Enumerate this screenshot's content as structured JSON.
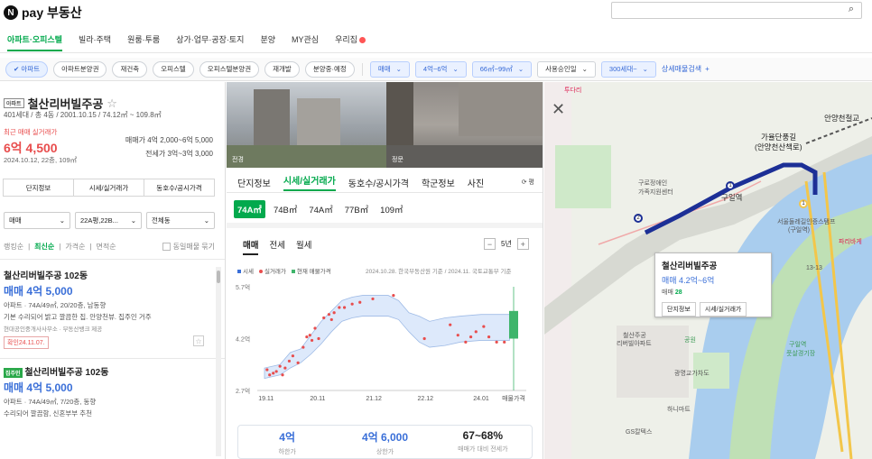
{
  "header": {
    "logo_text": "pay 부동산",
    "logo_mark": "N",
    "search_icon": "⌕"
  },
  "nav": {
    "items": [
      "아파트·오피스텔",
      "빌라·주택",
      "원룸·투룸",
      "상가·업무·공장·토지",
      "분양",
      "MY관심",
      "우리집"
    ]
  },
  "filters": {
    "chips": [
      "✔ 아파트",
      "아파트분양권",
      "재건축",
      "오피스텔",
      "오피스텔분양권",
      "재개발",
      "분양중·예정"
    ],
    "selects": [
      "매매",
      "4억~6억",
      "66㎡~99㎡",
      "사용승인일",
      "300세대~"
    ],
    "detail_label": "상세매물검색",
    "detail_plus": "+"
  },
  "listing": {
    "type_tag": "아파트",
    "title": "철산리버빌주공",
    "star": "☆",
    "subtitle": "401세대 / 총 4동 / 2001.10.15 / 74.12㎡ ~ 109.8㎡",
    "recent_label": "최근 매매 실거래가",
    "recent_price": "6억 4,500",
    "recent_date": "2024.10.12, 22층, 109㎡",
    "sale_range": "매매가 4억 2,000~6억 5,000",
    "jeonse_range": "전세가 3억~3억 3,000",
    "buttons": [
      "단지정보",
      "시세/실거래가",
      "동호수/공시가격"
    ],
    "dropdowns": [
      "매매",
      "22A평,22B...",
      "전체동"
    ],
    "sort": [
      "랭킹순",
      "최신순",
      "가격순",
      "면적순"
    ],
    "same_listing": "동일매물 묶기",
    "items": [
      {
        "title": "철산리버빌주공 102동",
        "price": "매매 4억 5,000",
        "desc1": "아파트 · 74A/49㎡, 20/20층, 남동향",
        "desc2": "기본 수리되어 밝고 깔끔한 집. 안양천뷰. 집주인 거주",
        "source": "현대공인중개사사무소 · 부동산뱅크 제공",
        "badge": "확인24.11.07."
      },
      {
        "tag": "집주인",
        "title": "철산리버빌주공 102동",
        "price": "매매 4억 5,000",
        "desc1": "아파트 · 74A/49㎡, 7/20층, 동향",
        "desc2": "수리되어 깔끔함, 신혼부부 추천"
      }
    ]
  },
  "detail": {
    "photo_labels": [
      "전경",
      "정문"
    ],
    "tabs": [
      "단지정보",
      "시세/실거래가",
      "동호수/공시가격",
      "학군정보",
      "사진"
    ],
    "refresh": "⟳ 평",
    "areas": [
      "74A㎡",
      "74B㎡",
      "74A㎡",
      "77B㎡",
      "109㎡"
    ],
    "chart_tabs": [
      "매매",
      "전세",
      "월세"
    ],
    "years": "5년",
    "minus": "−",
    "plus": "+",
    "legend": [
      "시세",
      "실거래가",
      "현재 매물가격"
    ],
    "source": "2024.10.28. 한국부동산원 기준 / 2024.11. 국토교통부 기준",
    "stats": [
      {
        "value": "4억",
        "label": "하한가"
      },
      {
        "value": "4억 6,000",
        "label": "상한가"
      },
      {
        "value": "67~68%",
        "label": "매매가 대비 전세가"
      }
    ]
  },
  "chart_data": {
    "type": "scatter",
    "title": "",
    "xlabel": "",
    "ylabel": "",
    "x_ticks": [
      "19.11",
      "20.11",
      "21.12",
      "22.12",
      "24.01"
    ],
    "x_tick_pos": [
      2019.83,
      2020.83,
      2021.92,
      2022.92,
      2024.0
    ],
    "extra_x_label": "매물가격",
    "y_ticks": [
      "5.7억",
      "4.2억",
      "2.7억"
    ],
    "y_tick_values": [
      5.7,
      4.2,
      2.7
    ],
    "ylim": [
      2.7,
      5.7
    ],
    "xlim": [
      2019.8,
      2024.7
    ],
    "band_upper": [
      [
        2019.8,
        3.35
      ],
      [
        2020.1,
        3.45
      ],
      [
        2020.3,
        3.8
      ],
      [
        2020.5,
        3.9
      ],
      [
        2020.7,
        4.3
      ],
      [
        2020.9,
        4.7
      ],
      [
        2021.1,
        5.0
      ],
      [
        2021.3,
        5.3
      ],
      [
        2021.5,
        5.4
      ],
      [
        2021.7,
        5.45
      ],
      [
        2022.0,
        5.45
      ],
      [
        2022.2,
        5.45
      ],
      [
        2022.4,
        5.3
      ],
      [
        2022.6,
        4.95
      ],
      [
        2022.8,
        4.85
      ],
      [
        2023.0,
        4.7
      ],
      [
        2023.3,
        4.8
      ],
      [
        2023.6,
        4.85
      ],
      [
        2024.0,
        4.9
      ],
      [
        2024.4,
        4.9
      ],
      [
        2024.55,
        4.9
      ]
    ],
    "band_lower": [
      [
        2019.8,
        3.05
      ],
      [
        2020.1,
        3.15
      ],
      [
        2020.3,
        3.35
      ],
      [
        2020.5,
        3.5
      ],
      [
        2020.7,
        3.75
      ],
      [
        2020.9,
        4.05
      ],
      [
        2021.1,
        4.4
      ],
      [
        2021.3,
        4.7
      ],
      [
        2021.5,
        4.8
      ],
      [
        2021.7,
        4.85
      ],
      [
        2022.0,
        4.85
      ],
      [
        2022.2,
        4.85
      ],
      [
        2022.4,
        4.75
      ],
      [
        2022.6,
        4.4
      ],
      [
        2022.8,
        4.1
      ],
      [
        2023.0,
        3.95
      ],
      [
        2023.3,
        4.0
      ],
      [
        2023.6,
        4.1
      ],
      [
        2024.0,
        4.15
      ],
      [
        2024.4,
        4.15
      ],
      [
        2024.55,
        4.15
      ]
    ],
    "transactions": [
      [
        2019.85,
        3.3
      ],
      [
        2019.9,
        3.15
      ],
      [
        2019.97,
        3.2
      ],
      [
        2020.03,
        3.25
      ],
      [
        2020.1,
        3.4
      ],
      [
        2020.15,
        3.15
      ],
      [
        2020.2,
        3.35
      ],
      [
        2020.28,
        3.55
      ],
      [
        2020.35,
        3.7
      ],
      [
        2020.45,
        3.5
      ],
      [
        2020.55,
        3.95
      ],
      [
        2020.62,
        4.25
      ],
      [
        2020.68,
        4.3
      ],
      [
        2020.72,
        4.15
      ],
      [
        2020.78,
        4.5
      ],
      [
        2020.85,
        4.2
      ],
      [
        2020.95,
        4.8
      ],
      [
        2021.05,
        4.9
      ],
      [
        2021.1,
        4.75
      ],
      [
        2021.15,
        4.95
      ],
      [
        2021.25,
        5.1
      ],
      [
        2021.35,
        5.1
      ],
      [
        2021.5,
        5.2
      ],
      [
        2021.65,
        5.25
      ],
      [
        2021.9,
        5.35
      ],
      [
        2022.3,
        5.45
      ],
      [
        2022.9,
        4.2
      ],
      [
        2023.4,
        4.6
      ],
      [
        2023.55,
        4.3
      ],
      [
        2023.7,
        4.1
      ],
      [
        2023.8,
        4.25
      ],
      [
        2023.9,
        4.4
      ],
      [
        2024.05,
        4.55
      ],
      [
        2024.15,
        4.25
      ],
      [
        2024.3,
        4.1
      ],
      [
        2024.45,
        4.1
      ]
    ],
    "listing_range": [
      4.2,
      5.0
    ],
    "grid": false
  },
  "map": {
    "info_title": "철산리버빌주공",
    "info_price": "매매 4.2억~6억",
    "info_count_label": "매매",
    "info_count": "28",
    "info_buttons": [
      "단지정보",
      "시세/실거래가"
    ],
    "labels": [
      "가율단풍길",
      "(안양천산책로)",
      "구일역",
      "안양천철교",
      "구로정애인",
      "가족지원센터",
      "서울둘레길인증스탬프",
      "(구일역)",
      "철산주공",
      "리버빌아파트",
      "광명교가차도",
      "하니마트",
      "GS칼텍스",
      "구일역",
      "풋살경기장",
      "공원",
      "투다리",
      "파리바게",
      "13-13"
    ],
    "stations": [
      "1",
      "1",
      "2"
    ],
    "close": "✕"
  }
}
